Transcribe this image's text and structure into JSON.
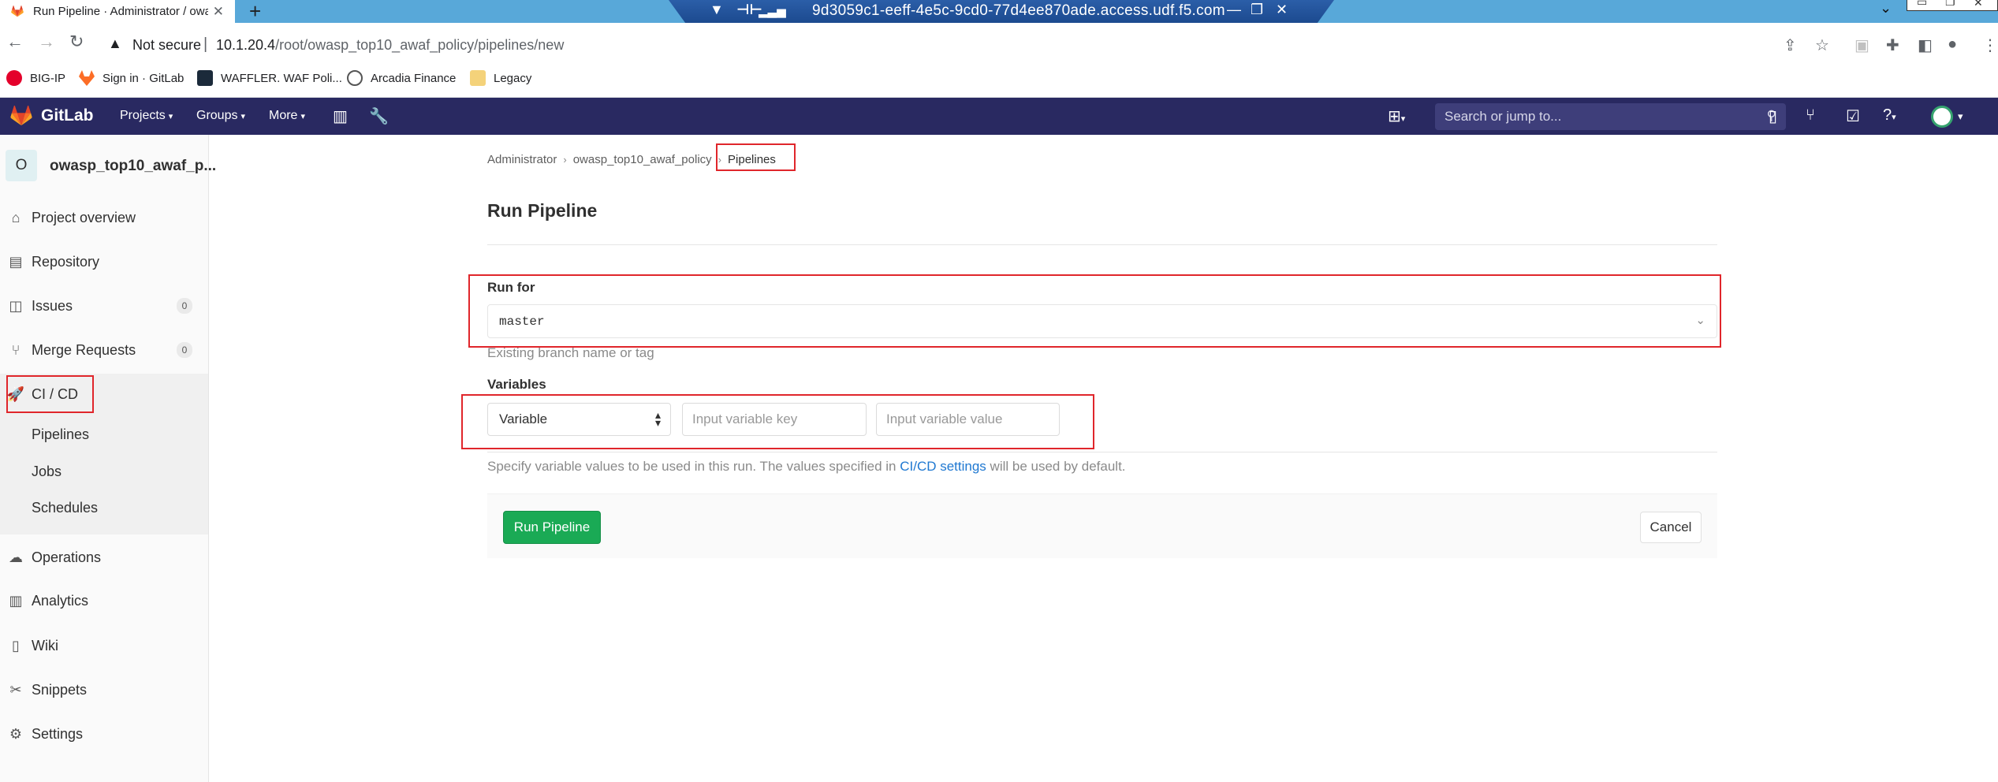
{
  "browser": {
    "tab_title": "Run Pipeline · Administrator / owasp",
    "tab_close": "✕",
    "new_tab": "+",
    "remote_title": "9d3059c1-eeff-4e5c-9cd0-77d4ee870ade.access.udf.f5.com",
    "not_secure": "Not secure",
    "url_host": "10.1.20.4",
    "url_path": "/root/owasp_top10_awaf_policy/pipelines/new",
    "bookmarks": [
      {
        "label": "BIG-IP",
        "icon": "f5-icon",
        "color": "#e4002b"
      },
      {
        "label": "Sign in · GitLab",
        "icon": "gitlab-icon",
        "color": "#fc6d26"
      },
      {
        "label": "WAFFLER. WAF Poli...",
        "icon": "waffler-icon",
        "color": "#1b2a3a"
      },
      {
        "label": "Arcadia Finance",
        "icon": "globe-icon",
        "color": "#555555"
      },
      {
        "label": "Legacy",
        "icon": "folder-icon",
        "color": "#f4d27a"
      }
    ]
  },
  "gitlab": {
    "brand": "GitLab",
    "nav": {
      "projects": "Projects",
      "groups": "Groups",
      "more": "More"
    },
    "search_placeholder": "Search or jump to...",
    "brand_color": "#292961"
  },
  "sidebar": {
    "project_initial": "O",
    "project_name": "owasp_top10_awaf_p...",
    "items": [
      {
        "label": "Project overview",
        "icon": "home-icon"
      },
      {
        "label": "Repository",
        "icon": "repository-icon"
      },
      {
        "label": "Issues",
        "icon": "issues-icon",
        "count": "0"
      },
      {
        "label": "Merge Requests",
        "icon": "merge-request-icon",
        "count": "0"
      },
      {
        "label": "CI / CD",
        "icon": "rocket-icon"
      },
      {
        "label": "Operations",
        "icon": "cloud-gear-icon"
      },
      {
        "label": "Analytics",
        "icon": "chart-icon"
      },
      {
        "label": "Wiki",
        "icon": "book-icon"
      },
      {
        "label": "Snippets",
        "icon": "scissors-icon"
      },
      {
        "label": "Settings",
        "icon": "gear-icon"
      }
    ],
    "cicd_sub": [
      "Pipelines",
      "Jobs",
      "Schedules"
    ]
  },
  "main": {
    "breadcrumb": [
      "Administrator",
      "owasp_top10_awaf_policy",
      "Pipelines"
    ],
    "title": "Run Pipeline",
    "run_for_label": "Run for",
    "ref_value": "master",
    "ref_help": "Existing branch name or tag",
    "variables_label": "Variables",
    "var_type": "Variable",
    "var_key_placeholder": "Input variable key",
    "var_value_placeholder": "Input variable value",
    "var_help_prefix": "Specify variable values to be used in this run. The values specified in ",
    "var_help_link": "CI/CD settings",
    "var_help_suffix": " will be used by default.",
    "run_button": "Run Pipeline",
    "cancel_button": "Cancel",
    "accent_green": "#1aaa55",
    "link_blue": "#1f78d1",
    "annotation_red": "#e0262b"
  }
}
